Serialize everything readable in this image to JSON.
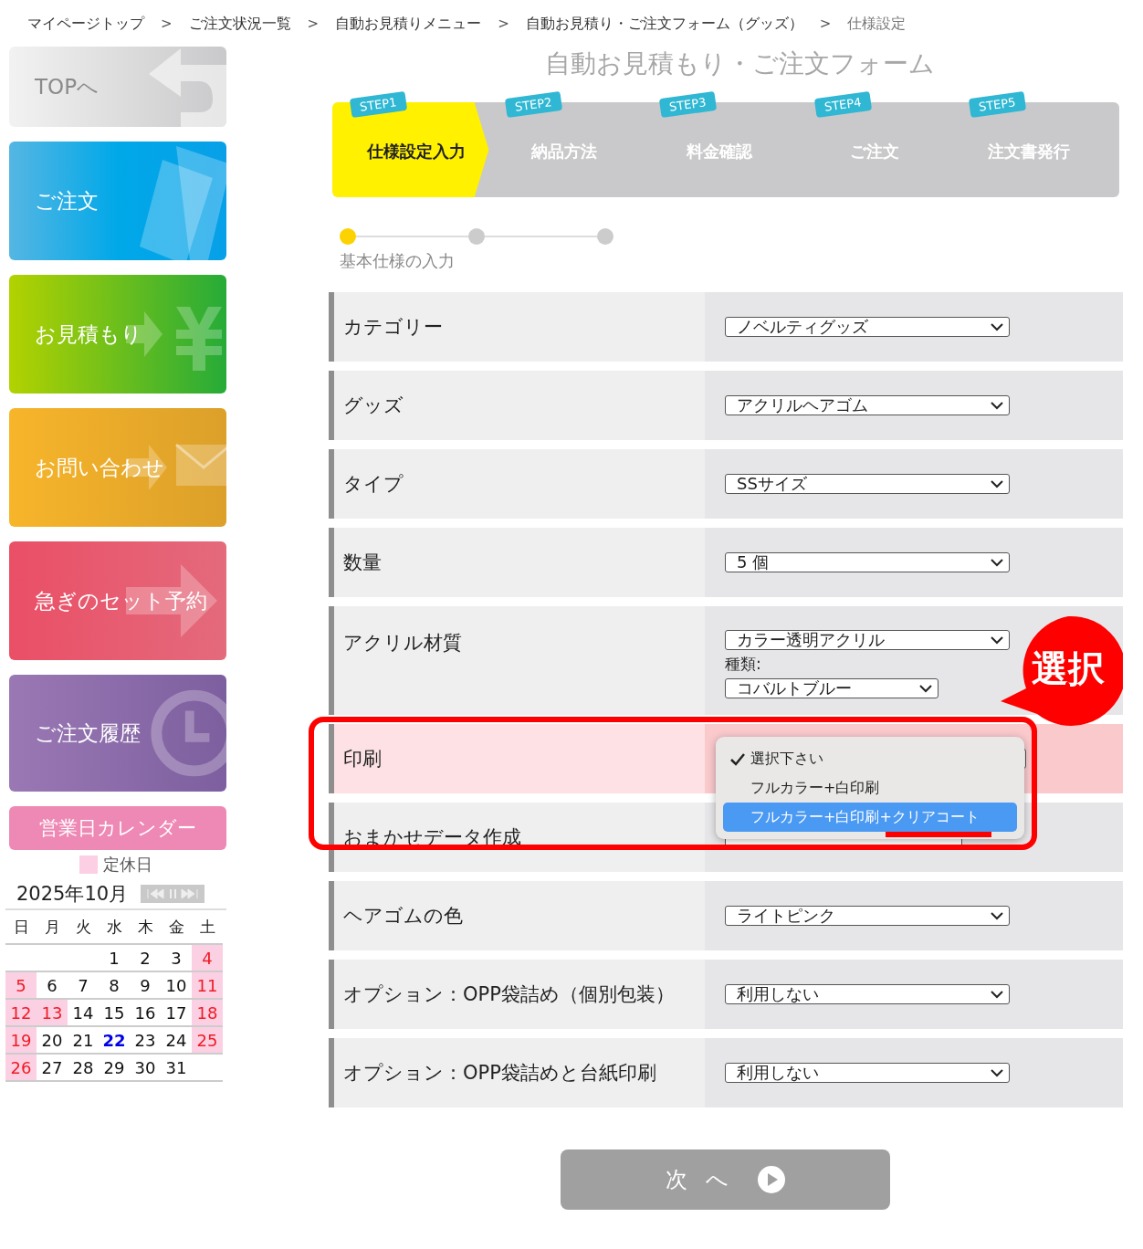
{
  "breadcrumb": [
    {
      "label": "マイページトップ",
      "current": false
    },
    {
      "label": "ご注文状況一覧",
      "current": false
    },
    {
      "label": "自動お見積りメニュー",
      "current": false
    },
    {
      "label": "自動お見積り・ご注文フォーム（グッズ）",
      "current": false
    },
    {
      "label": "仕様設定",
      "current": true
    }
  ],
  "breadcrumb_separator": ">",
  "sidebar": {
    "buttons": [
      {
        "kind": "top",
        "label": "TOPへ"
      },
      {
        "kind": "order",
        "label": "ご注文"
      },
      {
        "kind": "estimate",
        "label": "お見積もり"
      },
      {
        "kind": "contact",
        "label": "お問い合わせ"
      },
      {
        "kind": "reserve",
        "label": "急ぎのセット予約"
      },
      {
        "kind": "history",
        "label": "ご注文履歴"
      }
    ],
    "calendar": {
      "title": "営業日カレンダー",
      "legend": "定休日",
      "month": "2025年10月",
      "weekdays": [
        "日",
        "月",
        "火",
        "水",
        "木",
        "金",
        "土"
      ],
      "weeks": [
        [
          {
            "day": "1",
            "holiday": false,
            "today": false
          },
          {
            "day": "2",
            "holiday": false,
            "today": false
          },
          {
            "day": "3",
            "holiday": false,
            "today": false
          },
          {
            "day": "4",
            "holiday": true,
            "today": false
          }
        ],
        [
          {
            "day": "5",
            "holiday": true,
            "today": false
          },
          {
            "day": "6",
            "holiday": false,
            "today": false
          },
          {
            "day": "7",
            "holiday": false,
            "today": false
          },
          {
            "day": "8",
            "holiday": false,
            "today": false
          },
          {
            "day": "9",
            "holiday": false,
            "today": false
          },
          {
            "day": "10",
            "holiday": false,
            "today": false
          },
          {
            "day": "11",
            "holiday": true,
            "today": false
          }
        ],
        [
          {
            "day": "12",
            "holiday": true,
            "today": false
          },
          {
            "day": "13",
            "holiday": true,
            "today": false
          },
          {
            "day": "14",
            "holiday": false,
            "today": false
          },
          {
            "day": "15",
            "holiday": false,
            "today": false
          },
          {
            "day": "16",
            "holiday": false,
            "today": false
          },
          {
            "day": "17",
            "holiday": false,
            "today": false
          },
          {
            "day": "18",
            "holiday": true,
            "today": false
          }
        ],
        [
          {
            "day": "19",
            "holiday": true,
            "today": false
          },
          {
            "day": "20",
            "holiday": false,
            "today": false
          },
          {
            "day": "21",
            "holiday": false,
            "today": false
          },
          {
            "day": "22",
            "holiday": false,
            "today": true
          },
          {
            "day": "23",
            "holiday": false,
            "today": false
          },
          {
            "day": "24",
            "holiday": false,
            "today": false
          },
          {
            "day": "25",
            "holiday": true,
            "today": false
          }
        ],
        [
          {
            "day": "26",
            "holiday": true,
            "today": false
          },
          {
            "day": "27",
            "holiday": false,
            "today": false
          },
          {
            "day": "28",
            "holiday": false,
            "today": false
          },
          {
            "day": "29",
            "holiday": false,
            "today": false
          },
          {
            "day": "30",
            "holiday": false,
            "today": false
          },
          {
            "day": "31",
            "holiday": false,
            "today": false
          }
        ]
      ]
    }
  },
  "title": "自動お見積もり・ご注文フォーム",
  "steps": [
    {
      "tag": "STEP1",
      "label": "仕様設定入力",
      "selected": true
    },
    {
      "tag": "STEP2",
      "label": "納品方法",
      "selected": false
    },
    {
      "tag": "STEP3",
      "label": "料金確認",
      "selected": false
    },
    {
      "tag": "STEP4",
      "label": "ご注文",
      "selected": false
    },
    {
      "tag": "STEP5",
      "label": "注文書発行",
      "selected": false
    }
  ],
  "substeps": {
    "dots": [
      {
        "selected": true
      },
      {
        "selected": false
      },
      {
        "selected": false
      }
    ],
    "label": "基本仕様の入力"
  },
  "form_rows": [
    {
      "label": "カテゴリー",
      "highlighted": false,
      "fields": [
        {
          "kind": "select",
          "value": "ノベルティグッズ"
        }
      ]
    },
    {
      "label": "グッズ",
      "highlighted": false,
      "fields": [
        {
          "kind": "select",
          "value": "アクリルヘアゴム"
        }
      ]
    },
    {
      "label": "タイプ",
      "highlighted": false,
      "fields": [
        {
          "kind": "select",
          "value": "SSサイズ"
        }
      ]
    },
    {
      "label": "数量",
      "highlighted": false,
      "fields": [
        {
          "kind": "select",
          "value": "5 個"
        }
      ]
    },
    {
      "label": "アクリル材質",
      "highlighted": false,
      "fields": [
        {
          "kind": "select",
          "value": "カラー透明アクリル"
        },
        {
          "kind": "caption",
          "text": "種類:"
        },
        {
          "kind": "short_select",
          "value": "コバルトブルー"
        }
      ]
    },
    {
      "label": "印刷",
      "highlighted": true,
      "fields": [
        {
          "kind": "open_select",
          "options": [
            {
              "label": "選択下さい",
              "checked": true,
              "highlighted": false
            },
            {
              "label": "フルカラー+白印刷",
              "checked": false,
              "highlighted": false
            },
            {
              "label": "フルカラー+白印刷+クリアコート",
              "checked": false,
              "highlighted": true
            }
          ]
        }
      ]
    },
    {
      "label": "おまかせデータ作成",
      "highlighted": false,
      "fields": [
        {
          "kind": "covered_select"
        }
      ]
    },
    {
      "label": "ヘアゴムの色",
      "highlighted": false,
      "fields": [
        {
          "kind": "select",
          "value": "ライトピンク"
        }
      ]
    },
    {
      "label": "オプション：OPP袋詰め（個別包装）",
      "highlighted": false,
      "fields": [
        {
          "kind": "select",
          "value": "利用しない"
        }
      ]
    },
    {
      "label": "オプション：OPP袋詰めと台紙印刷",
      "highlighted": false,
      "fields": [
        {
          "kind": "select",
          "value": "利用しない"
        }
      ]
    }
  ],
  "callout": "選択",
  "next_button": "次 へ"
}
